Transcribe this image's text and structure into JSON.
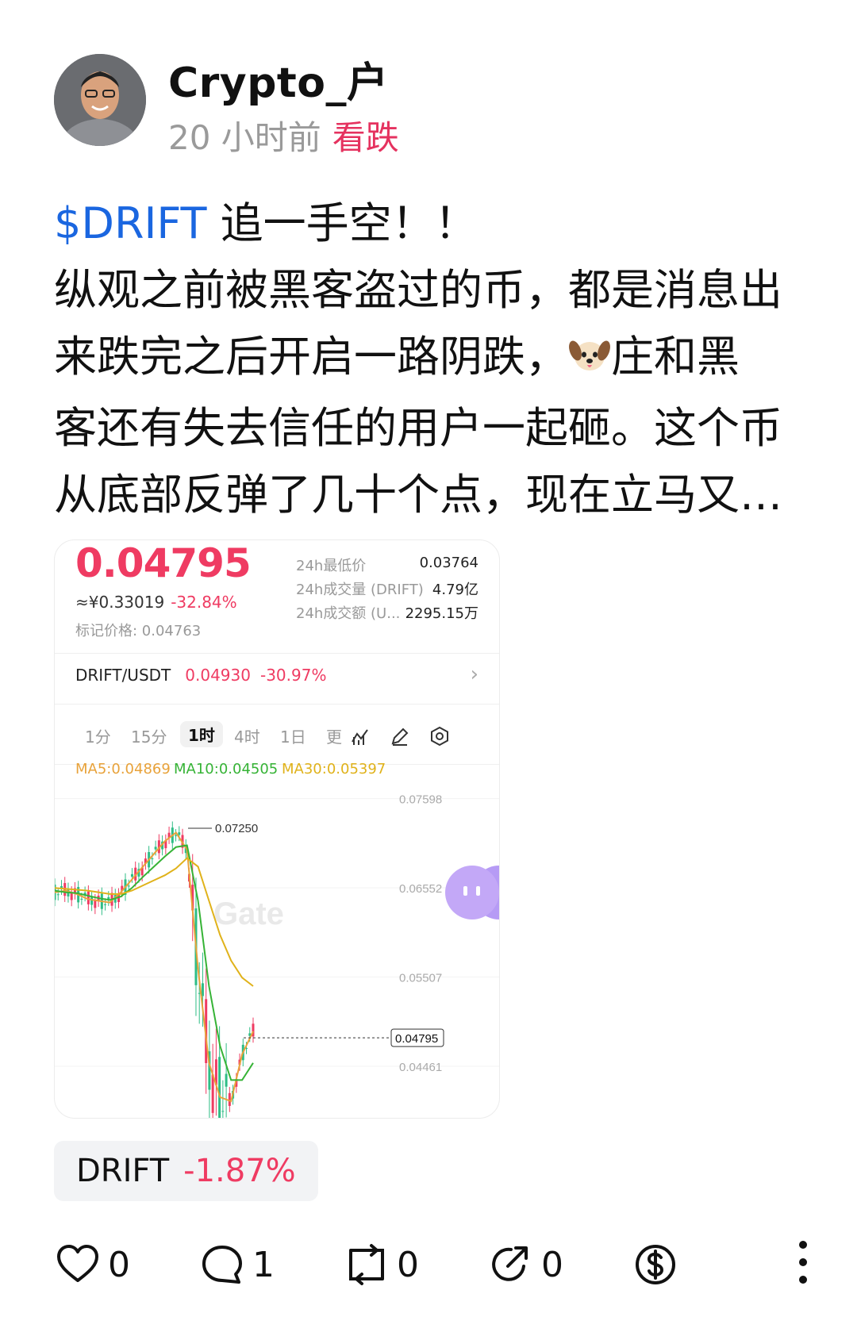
{
  "author": {
    "name": "Crypto_户",
    "time": "20 小时前",
    "sentiment": "看跌",
    "sentiment_color": "#e5325f"
  },
  "post": {
    "ticker": "$DRIFT",
    "line1_rest": " 追一手空！！",
    "line2": "纵观之前被黑客盗过的币，都是消息出",
    "line3a": "来跌完之后开启一路阴跌，",
    "line3b": "庄和黑",
    "line4": "客还有失去信任的用户一起砸。这个币",
    "line5": "从底部反弹了几十个点，现在立马又…",
    "emoji": "dog-face-icon"
  },
  "card": {
    "price": "0.04795",
    "cny": "≈¥0.33019",
    "cny_pct": "-32.84%",
    "mark_price": "标记价格: 0.04763",
    "stats": [
      {
        "label": "24h最低价",
        "value": "0.03764"
      },
      {
        "label": "24h成交量 (DRIFT)",
        "value": "4.79亿"
      },
      {
        "label": "24h成交额 (U...",
        "value": "2295.15万"
      }
    ],
    "pair": "DRIFT/USDT",
    "pair_price": "0.04930",
    "pair_pct": "-30.97%",
    "tabs": [
      "1分",
      "15分",
      "1时",
      "4时",
      "1日",
      "更"
    ],
    "active_tab": "1时",
    "ma": {
      "ma5": "MA5:0.04869",
      "ma10": "MA10:0.04505",
      "ma30": "MA30:0.05397"
    },
    "watermark": "Gate"
  },
  "chart_data": {
    "type": "line",
    "title": "",
    "y_ticks": [
      "0.07598",
      "0.06552",
      "0.05507",
      "0.04461"
    ],
    "high_label": "0.07250",
    "current_label": "0.04795",
    "series": [
      {
        "name": "MA5",
        "color": "#e8a23a",
        "values": [
          0.065,
          0.0652,
          0.0648,
          0.0642,
          0.064,
          0.0638,
          0.065,
          0.0665,
          0.068,
          0.0695,
          0.071,
          0.072,
          0.07,
          0.056,
          0.045,
          0.041,
          0.0405,
          0.046,
          0.0487
        ]
      },
      {
        "name": "MA10",
        "color": "#36b336",
        "values": [
          0.0652,
          0.065,
          0.0649,
          0.0646,
          0.0643,
          0.0641,
          0.0645,
          0.0655,
          0.0668,
          0.068,
          0.0692,
          0.0703,
          0.0705,
          0.064,
          0.054,
          0.047,
          0.043,
          0.043,
          0.045
        ]
      },
      {
        "name": "MA30",
        "color": "#e0b21a",
        "values": [
          0.0655,
          0.0654,
          0.0653,
          0.0652,
          0.065,
          0.0648,
          0.0648,
          0.0652,
          0.0658,
          0.0664,
          0.067,
          0.0678,
          0.069,
          0.068,
          0.064,
          0.06,
          0.057,
          0.055,
          0.054
        ]
      }
    ],
    "ylim": [
      0.0395,
      0.0765
    ]
  },
  "chip": {
    "symbol": "DRIFT",
    "change": "-1.87%"
  },
  "actions": {
    "likes": "0",
    "comments": "1",
    "reposts": "0",
    "shares": "0"
  }
}
